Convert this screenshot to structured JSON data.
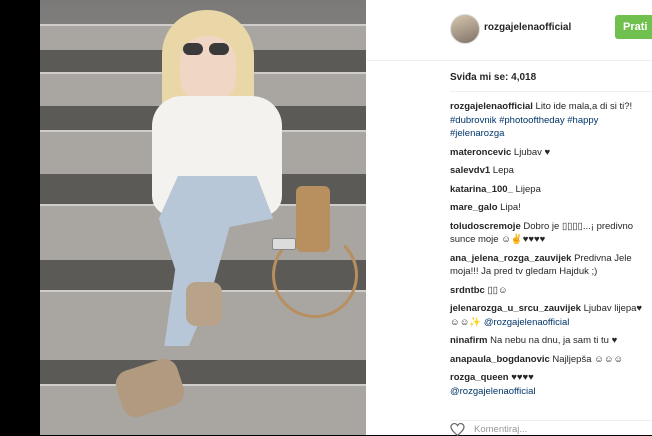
{
  "profile": {
    "username": "rozgajelenaofficial",
    "follow_label": "Prati"
  },
  "likes": {
    "label": "Sviđa mi se:",
    "count": "4,018"
  },
  "caption": {
    "user": "rozgajelenaofficial",
    "text": "Lito ide mala,a di si ti?!",
    "hashtags": "#dubrovnik #photooftheday #happy #jelenarozga"
  },
  "comments": [
    {
      "user": "materoncevic",
      "text": "Ljubav ♥"
    },
    {
      "user": "salevdv1",
      "text": "Lepa"
    },
    {
      "user": "katarina_100_",
      "text": "Lijepa"
    },
    {
      "user": "mare_galo",
      "text": "Lipa!"
    },
    {
      "user": "toludoscremoje",
      "text": "Dobro je ▯▯▯▯...¡ predivno sunce moje ☺✌♥♥♥♥"
    },
    {
      "user": "ana_jelena_rozga_zauvijek",
      "text": "Predivna Jele moja!!! Ja pred tv gledam Hajduk ;)"
    },
    {
      "user": "srdntbc",
      "text": "▯▯☺"
    },
    {
      "user": "jelenarozga_u_srcu_zauvijek",
      "text": "Ljubav lijepa♥☺☺✨",
      "mention": "@rozgajelenaofficial"
    },
    {
      "user": "ninafirm",
      "text": "Na nebu na dnu, ja sam ti tu ♥"
    },
    {
      "user": "anapaula_bogdanovic",
      "text": "Najljepša ☺☺☺"
    },
    {
      "user": "rozga_queen",
      "text": "♥♥♥♥",
      "mention": "@rozgajelenaofficial"
    }
  ],
  "footer": {
    "placeholder": "Komentiraj..."
  }
}
